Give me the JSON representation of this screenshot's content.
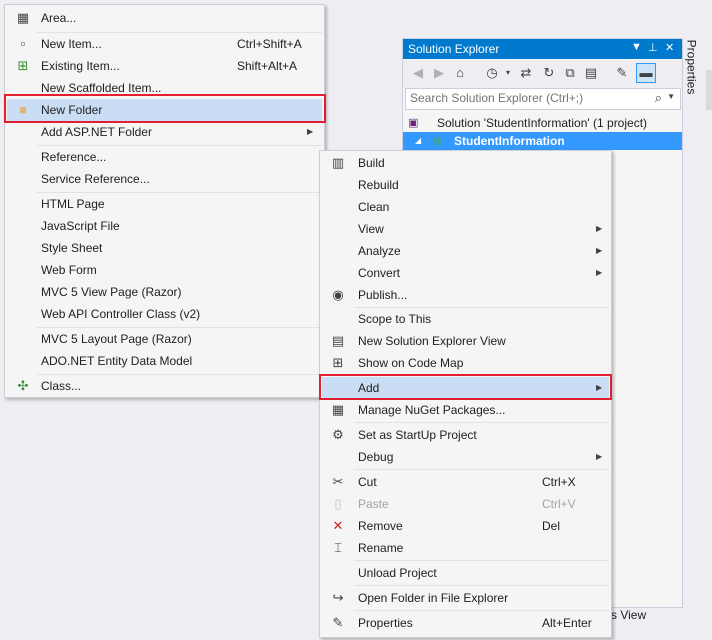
{
  "solution_explorer": {
    "title": "Solution Explorer",
    "search_placeholder": "Search Solution Explorer (Ctrl+;)",
    "solution_label": "Solution 'StudentInformation' (1 project)",
    "project_label": "StudentInformation",
    "class_view_tab": "ss View"
  },
  "properties_tab": "Properties",
  "add_menu": {
    "items": [
      {
        "label": "Area..."
      },
      {
        "label": "New Item...",
        "shortcut": "Ctrl+Shift+A"
      },
      {
        "label": "Existing Item...",
        "shortcut": "Shift+Alt+A"
      },
      {
        "label": "New Scaffolded Item..."
      },
      {
        "label": "New Folder"
      },
      {
        "label": "Add ASP.NET Folder"
      },
      {
        "label": "Reference..."
      },
      {
        "label": "Service Reference..."
      },
      {
        "label": "HTML Page"
      },
      {
        "label": "JavaScript File"
      },
      {
        "label": "Style Sheet"
      },
      {
        "label": "Web Form"
      },
      {
        "label": "MVC 5 View Page (Razor)"
      },
      {
        "label": "Web API Controller Class (v2)"
      },
      {
        "label": "MVC 5 Layout Page (Razor)"
      },
      {
        "label": "ADO.NET Entity Data Model"
      },
      {
        "label": "Class..."
      }
    ]
  },
  "context_menu": {
    "items": [
      {
        "label": "Build"
      },
      {
        "label": "Rebuild"
      },
      {
        "label": "Clean"
      },
      {
        "label": "View"
      },
      {
        "label": "Analyze"
      },
      {
        "label": "Convert"
      },
      {
        "label": "Publish..."
      },
      {
        "label": "Scope to This"
      },
      {
        "label": "New Solution Explorer View"
      },
      {
        "label": "Show on Code Map"
      },
      {
        "label": "Add"
      },
      {
        "label": "Manage NuGet Packages..."
      },
      {
        "label": "Set as StartUp Project"
      },
      {
        "label": "Debug"
      },
      {
        "label": "Cut",
        "shortcut": "Ctrl+X"
      },
      {
        "label": "Paste",
        "shortcut": "Ctrl+V"
      },
      {
        "label": "Remove",
        "shortcut": "Del"
      },
      {
        "label": "Rename"
      },
      {
        "label": "Unload Project"
      },
      {
        "label": "Open Folder in File Explorer"
      },
      {
        "label": "Properties",
        "shortcut": "Alt+Enter"
      }
    ]
  },
  "colors": {
    "accent": "#007acc",
    "selection": "#3399ff",
    "menu_highlight": "#c9def5",
    "callout_red": "#e0202e"
  }
}
